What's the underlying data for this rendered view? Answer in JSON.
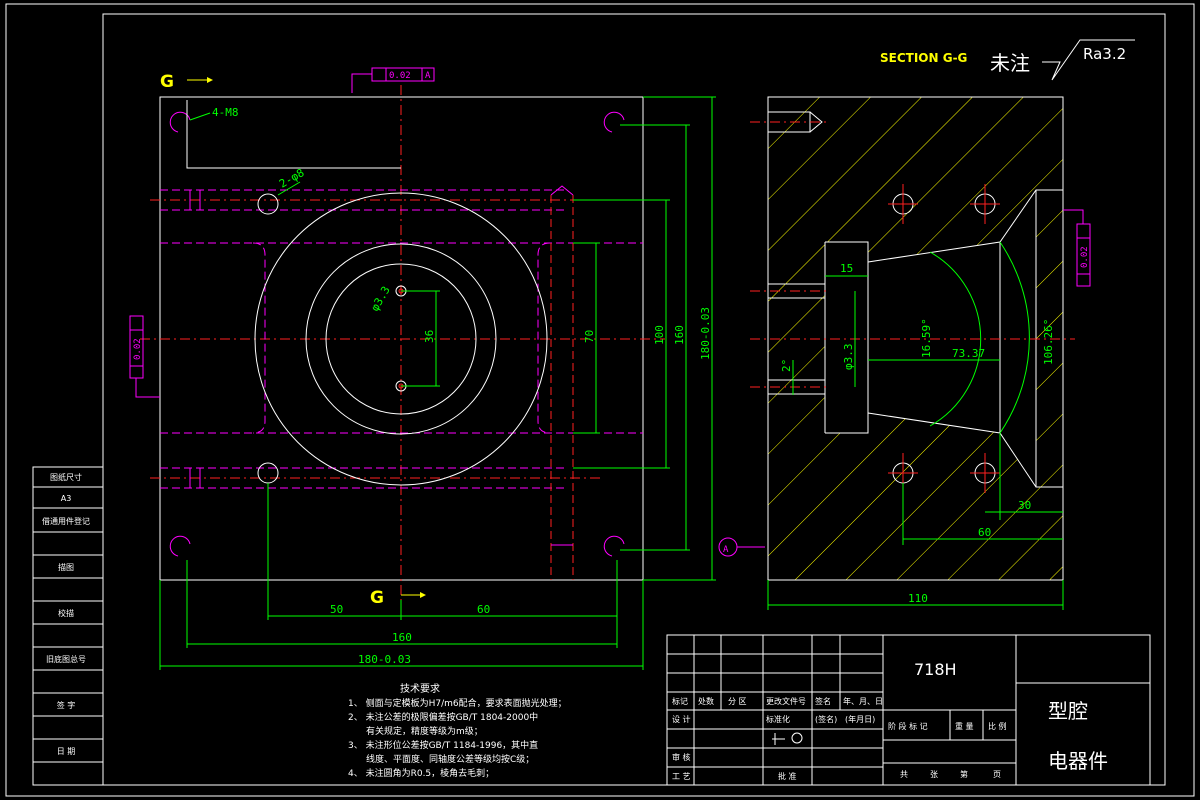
{
  "section_title": "SECTION G-G",
  "note_label": "未注",
  "roughness": "Ra3.2",
  "section_marks": [
    "G",
    "G"
  ],
  "datum_label": "A",
  "tolerance_top": "0.02",
  "tolerance_left": "0.02",
  "tolerance_right": "0.02",
  "hole_callouts": {
    "corner": "4-M8",
    "pin": "2-φ8"
  },
  "dimensions_front": {
    "d_36": "36",
    "d_70": "70",
    "d_100": "100",
    "d_160_v": "160",
    "d_180_v": "180-0.03",
    "d_50": "50",
    "d_60": "60",
    "d_160_h": "160",
    "d_180_h": "180-0.03",
    "d_hole": "φ3.3"
  },
  "dimensions_section": {
    "d_15": "15",
    "d_angle_small": "2°",
    "d_hole": "φ3.3",
    "d_angle1": "16.59°",
    "d_73": "73.37",
    "d_angle2": "106.26°",
    "d_30": "30",
    "d_60": "60",
    "d_110": "110"
  },
  "tech_req": {
    "title": "技术要求",
    "lines": [
      "1、 侧面与定模板为H7/m6配合，要求表面抛光处理；",
      "2、 未注公差的极限偏差按GB/T 1804-2000中",
      "　　有关规定，精度等级为m级；",
      "3、 未注形位公差按GB/T 1184-1996，其中直",
      "　　线度、平面度、同轴度公差等级均按C级；",
      "4、 未注圆角为R0.5，棱角去毛刺；"
    ]
  },
  "left_column": [
    "图纸尺寸",
    "A3",
    "借通用件登记",
    "描图",
    "校描",
    "旧底图总号",
    "签 字",
    "日 期"
  ],
  "title_block": {
    "material": "718H",
    "part_name": "型腔",
    "product": "电器件",
    "row_headers": [
      "标记",
      "处数",
      "分 区",
      "更改文件号",
      "签名",
      "年、月、日"
    ],
    "design": "设 计",
    "standard": "标准化",
    "sign": "(签名)",
    "date": "(年月日)",
    "stage_cols": [
      "阶 段 标 记",
      "重 量",
      "比 例"
    ],
    "review": "审 核",
    "process": "工 艺",
    "approve": "批 准",
    "sheets": [
      "共",
      "张",
      "第",
      "页"
    ]
  }
}
